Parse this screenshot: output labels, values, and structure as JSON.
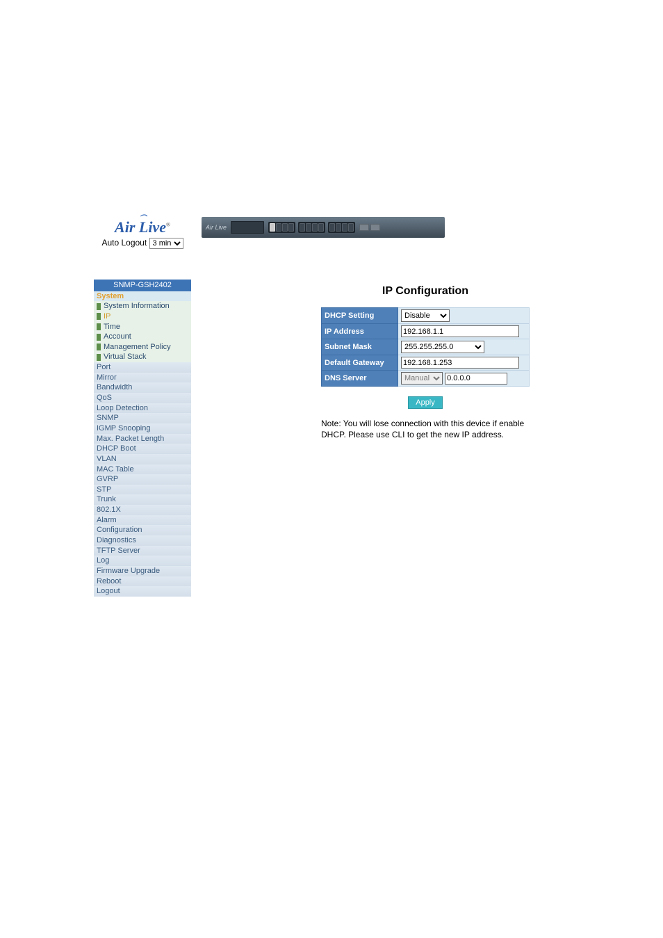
{
  "brand": {
    "name": "Air Live",
    "sup": "®"
  },
  "autoLogout": {
    "label": "Auto Logout",
    "value": "3 min"
  },
  "sidebar": {
    "title": "SNMP-GSH2402",
    "section": "System",
    "subs": [
      {
        "label": "System Information",
        "active": false
      },
      {
        "label": "IP",
        "active": true
      },
      {
        "label": "Time",
        "active": false
      },
      {
        "label": "Account",
        "active": false
      },
      {
        "label": "Management Policy",
        "active": false
      },
      {
        "label": "Virtual Stack",
        "active": false
      }
    ],
    "items": [
      "Port",
      "Mirror",
      "Bandwidth",
      "QoS",
      "Loop Detection",
      "SNMP",
      "IGMP Snooping",
      "Max. Packet Length",
      "DHCP Boot",
      "VLAN",
      "MAC Table",
      "GVRP",
      "STP",
      "Trunk",
      "802.1X",
      "Alarm",
      "Configuration",
      "Diagnostics",
      "TFTP Server",
      "Log",
      "Firmware Upgrade",
      "Reboot",
      "Logout"
    ]
  },
  "main": {
    "title": "IP Configuration",
    "rows": {
      "dhcp": {
        "label": "DHCP Setting",
        "value": "Disable"
      },
      "ip": {
        "label": "IP Address",
        "value": "192.168.1.1"
      },
      "mask": {
        "label": "Subnet Mask",
        "value": "255.255.255.0"
      },
      "gw": {
        "label": "Default Gateway",
        "value": "192.168.1.253"
      },
      "dns": {
        "label": "DNS Server",
        "mode": "Manual",
        "value": "0.0.0.0"
      }
    },
    "applyLabel": "Apply",
    "note": "Note: You will lose connection with this device if enable DHCP. Please use CLI to get the new IP address."
  }
}
